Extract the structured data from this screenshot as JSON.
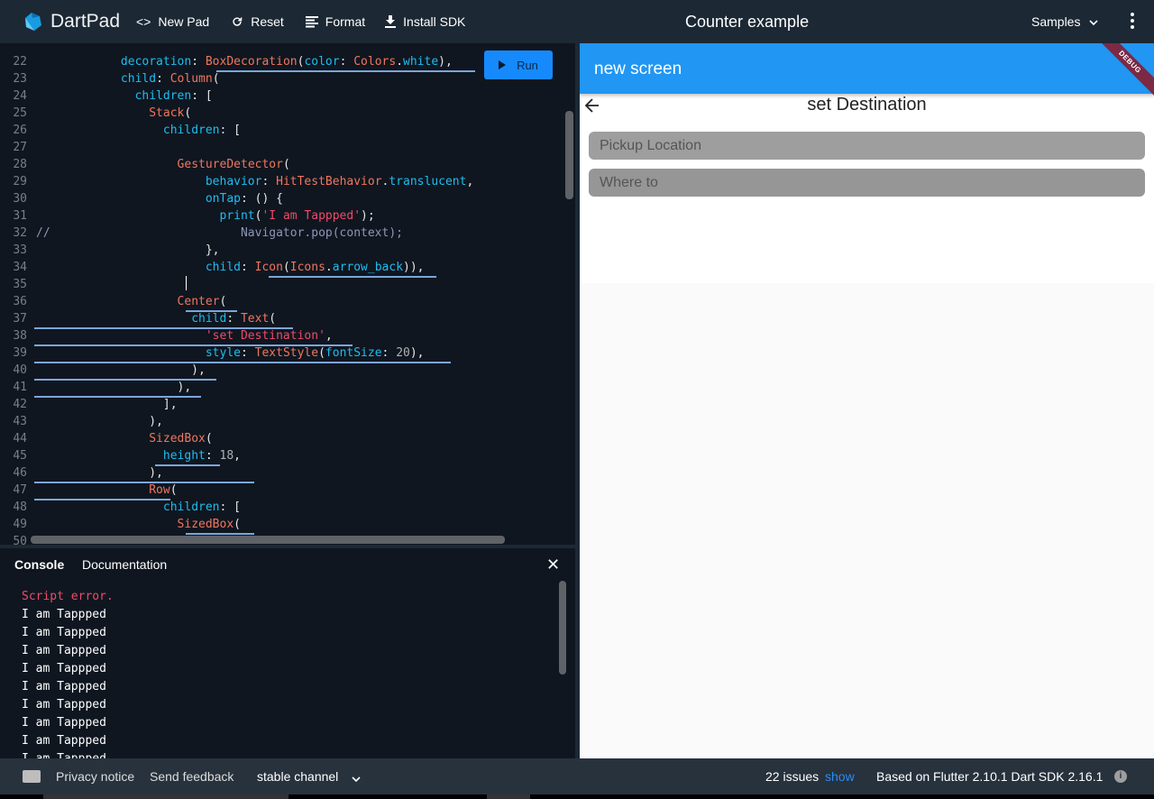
{
  "header": {
    "app_name": "DartPad",
    "buttons": [
      {
        "label": "New Pad",
        "icon": "code-brackets-icon"
      },
      {
        "label": "Reset",
        "icon": "refresh-icon"
      },
      {
        "label": "Format",
        "icon": "format-align-icon"
      },
      {
        "label": "Install SDK",
        "icon": "download-icon"
      }
    ],
    "title": "Counter example",
    "samples_label": "Samples",
    "more_icon": "more-vert-icon"
  },
  "editor": {
    "run_label": "Run",
    "lines": [
      {
        "n": "22",
        "html": "            <span class='kw'>decoration</span>: <span class='cls'>BoxDecoration</span>(<span class='kw'>color</span>: <span class='cls'>Colors</span>.<span class='kw'>white</span>),"
      },
      {
        "n": "23",
        "html": "            <span class='kw'>child</span>: <span class='cls'>Column</span>("
      },
      {
        "n": "24",
        "html": "              <span class='kw'>children</span>: ["
      },
      {
        "n": "25",
        "html": "                <span class='cls'>Stack</span>("
      },
      {
        "n": "26",
        "html": "                  <span class='kw'>children</span>: ["
      },
      {
        "n": "27",
        "html": ""
      },
      {
        "n": "28",
        "html": "                    <span class='cls'>GestureDetector</span>("
      },
      {
        "n": "29",
        "html": "                        <span class='kw'>behavior</span>: <span class='cls'>HitTestBehavior</span>.<span class='kw'>translucent</span>,"
      },
      {
        "n": "30",
        "html": "                        <span class='kw'>onTap</span>: () {"
      },
      {
        "n": "31",
        "html": "                          <span class='kw'>print</span>(<span class='str'>'I am Tappped'</span>);"
      },
      {
        "n": "32",
        "html": "<span class='cmt'>//                           Navigator.pop(context);</span>"
      },
      {
        "n": "33",
        "html": "                        },"
      },
      {
        "n": "34",
        "html": "                        <span class='kw'>child</span>: <span class='cls'>Icon</span>(<span class='cls'>Icons</span>.<span class='kw'>arrow_back</span>)),"
      },
      {
        "n": "35",
        "html": ""
      },
      {
        "n": "36",
        "html": "                    <span class='cls'>Center</span>("
      },
      {
        "n": "37",
        "html": "                      <span class='kw'>child</span>: <span class='cls'>Text</span>("
      },
      {
        "n": "38",
        "html": "                        <span class='str'>'set Destination'</span>,"
      },
      {
        "n": "39",
        "html": "                        <span class='kw'>style</span>: <span class='cls'>TextStyle</span>(<span class='kw'>fontSize</span>: <span class='num'>20</span>),"
      },
      {
        "n": "40",
        "html": "                      ),"
      },
      {
        "n": "41",
        "html": "                    ),"
      },
      {
        "n": "42",
        "html": "                  ],"
      },
      {
        "n": "43",
        "html": "                ),"
      },
      {
        "n": "44",
        "html": "                <span class='cls'>SizedBox</span>("
      },
      {
        "n": "45",
        "html": "                  <span class='kw'>height</span>: <span class='num'>18</span>,"
      },
      {
        "n": "46",
        "html": "                ),"
      },
      {
        "n": "47",
        "html": "                <span class='cls'>Row</span>("
      },
      {
        "n": "48",
        "html": "                  <span class='kw'>children</span>: ["
      },
      {
        "n": "49",
        "html": "                    <span class='cls'>SizedBox</span>("
      },
      {
        "n": "50",
        "html": ""
      }
    ]
  },
  "console": {
    "tabs": [
      "Console",
      "Documentation"
    ],
    "close_icon": "close-icon",
    "lines": [
      {
        "text": "Script error.",
        "error": true
      },
      {
        "text": "I am Tappped",
        "error": false
      },
      {
        "text": "I am Tappped",
        "error": false
      },
      {
        "text": "I am Tappped",
        "error": false
      },
      {
        "text": "I am Tappped",
        "error": false
      },
      {
        "text": "I am Tappped",
        "error": false
      },
      {
        "text": "I am Tappped",
        "error": false
      },
      {
        "text": "I am Tappped",
        "error": false
      },
      {
        "text": "I am Tappped",
        "error": false
      },
      {
        "text": "I am Tappped",
        "error": false
      }
    ]
  },
  "preview": {
    "appbar_title": "new screen",
    "debug_banner": "DEBUG",
    "heading": "set Destination",
    "fields": [
      {
        "placeholder": "Pickup Location"
      },
      {
        "placeholder": "Where to"
      }
    ],
    "colors": {
      "appbar": "#2196f3",
      "debug": "#7a2a45"
    }
  },
  "footer": {
    "privacy": "Privacy notice",
    "feedback": "Send feedback",
    "channel": "stable channel",
    "issues": "22 issues",
    "show": "show",
    "version": "Based on Flutter 2.10.1 Dart SDK 2.16.1"
  }
}
